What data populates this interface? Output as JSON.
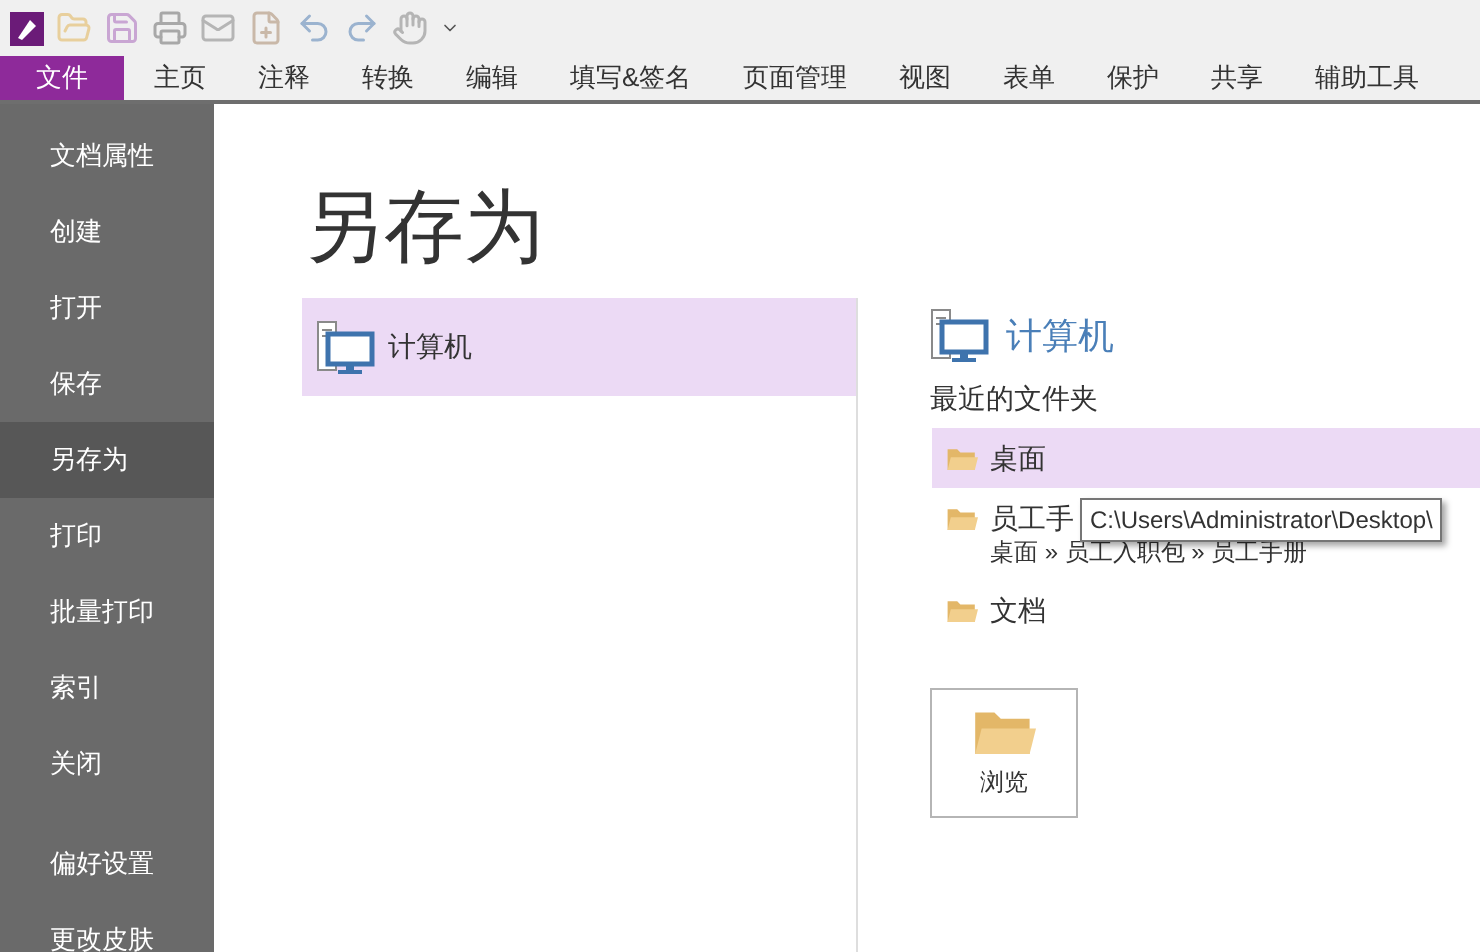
{
  "tabs": [
    {
      "label": "文件",
      "selected": true
    },
    {
      "label": "主页",
      "selected": false
    },
    {
      "label": "注释",
      "selected": false
    },
    {
      "label": "转换",
      "selected": false
    },
    {
      "label": "编辑",
      "selected": false
    },
    {
      "label": "填写&签名",
      "selected": false
    },
    {
      "label": "页面管理",
      "selected": false
    },
    {
      "label": "视图",
      "selected": false
    },
    {
      "label": "表单",
      "selected": false
    },
    {
      "label": "保护",
      "selected": false
    },
    {
      "label": "共享",
      "selected": false
    },
    {
      "label": "辅助工具",
      "selected": false
    }
  ],
  "sidebar": {
    "items": [
      {
        "label": "文档属性",
        "selected": false
      },
      {
        "label": "创建",
        "selected": false
      },
      {
        "label": "打开",
        "selected": false
      },
      {
        "label": "保存",
        "selected": false
      },
      {
        "label": "另存为",
        "selected": true
      },
      {
        "label": "打印",
        "selected": false
      },
      {
        "label": "批量打印",
        "selected": false
      },
      {
        "label": "索引",
        "selected": false
      },
      {
        "label": "关闭",
        "selected": false
      },
      {
        "kind": "divider"
      },
      {
        "label": "偏好设置",
        "selected": false
      },
      {
        "label": "更改皮肤",
        "selected": false
      }
    ]
  },
  "page_title": "另存为",
  "locations": [
    {
      "label": "计算机",
      "selected": true
    }
  ],
  "detail": {
    "heading": "计算机",
    "recent_label": "最近的文件夹",
    "folders": [
      {
        "name": "桌面",
        "selected": true
      },
      {
        "name": "员工手",
        "path": "桌面 » 员工入职包 » 员工手册",
        "selected": false
      },
      {
        "name": "文档",
        "selected": false
      }
    ],
    "browse": "浏览"
  },
  "tooltip": "C:\\Users\\Administrator\\Desktop\\"
}
